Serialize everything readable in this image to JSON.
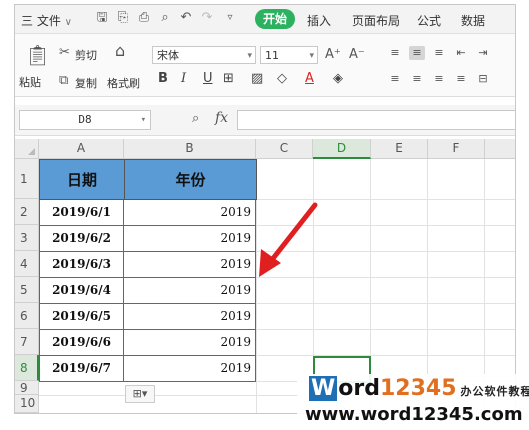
{
  "menubar": {
    "file_menu": "三 文件",
    "file_chevron": "∨",
    "tabs": [
      {
        "label": "开始"
      },
      {
        "label": "插入"
      },
      {
        "label": "页面布局"
      },
      {
        "label": "公式"
      },
      {
        "label": "数据"
      }
    ]
  },
  "ribbon": {
    "paste_label": "粘贴",
    "cut_label": "剪切",
    "copy_label": "复制",
    "format_painter_label": "格式刷",
    "font_name": "宋体",
    "font_size": "11",
    "font_grow": "A⁺",
    "font_shrink": "A⁻",
    "bold": "B",
    "italic": "I",
    "underline": "U",
    "font_color_glyph": "A"
  },
  "formula_bar": {
    "name_box": "D8",
    "fx_label": "fx",
    "formula": ""
  },
  "columns": [
    "A",
    "B",
    "C",
    "D",
    "E",
    "F"
  ],
  "selected_column": "D",
  "rows": [
    "1",
    "2",
    "3",
    "4",
    "5",
    "6",
    "7",
    "8",
    "9",
    "10"
  ],
  "selected_row": "8",
  "table": {
    "headers": [
      "日期",
      "年份"
    ],
    "data": [
      {
        "date": "2019/6/1",
        "year": "2019"
      },
      {
        "date": "2019/6/2",
        "year": "2019"
      },
      {
        "date": "2019/6/3",
        "year": "2019"
      },
      {
        "date": "2019/6/4",
        "year": "2019"
      },
      {
        "date": "2019/6/5",
        "year": "2019"
      },
      {
        "date": "2019/6/6",
        "year": "2019"
      },
      {
        "date": "2019/6/7",
        "year": "2019"
      }
    ]
  },
  "paste_options_glyph": "⊞▾",
  "watermark": {
    "brand_letter": "W",
    "brand_rest": "ord",
    "brand_num": "12345",
    "brand_cn": "办公软件教程",
    "url": "www.word12345.com"
  },
  "colors": {
    "accent_green": "#2bb15f",
    "header_fill": "#5b9bd5",
    "arrow_red": "#e02020",
    "selection_green": "#2e8b3e"
  }
}
